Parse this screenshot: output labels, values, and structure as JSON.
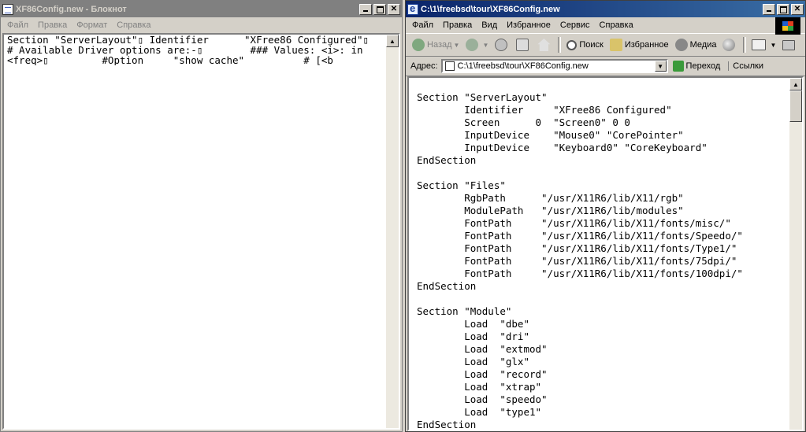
{
  "notepad": {
    "title": "XF86Config.new - Блокнот",
    "menu": [
      "Файл",
      "Правка",
      "Формат",
      "Справка"
    ],
    "lines": [
      "Section \"ServerLayout\"▯ Identifier      \"XFree86 Configured\"▯",
      "# Available Driver options are:-▯        ### Values: <i>: in",
      "<freq>▯         #Option     \"show_cache\"          # [<b"
    ]
  },
  "browser": {
    "title": "C:\\1\\freebsd\\tour\\XF86Config.new",
    "menu": [
      "Файл",
      "Правка",
      "Вид",
      "Избранное",
      "Сервис",
      "Справка"
    ],
    "toolbar": {
      "back": "Назад",
      "search": "Поиск",
      "favorites": "Избранное",
      "media": "Медиа"
    },
    "address": {
      "label": "Адрес:",
      "value": "C:\\1\\freebsd\\tour\\XF86Config.new",
      "go": "Переход",
      "links": "Ссылки"
    },
    "content_lines": [
      "Section \"ServerLayout\"",
      "        Identifier     \"XFree86 Configured\"",
      "        Screen      0  \"Screen0\" 0 0",
      "        InputDevice    \"Mouse0\" \"CorePointer\"",
      "        InputDevice    \"Keyboard0\" \"CoreKeyboard\"",
      "EndSection",
      "",
      "Section \"Files\"",
      "        RgbPath      \"/usr/X11R6/lib/X11/rgb\"",
      "        ModulePath   \"/usr/X11R6/lib/modules\"",
      "        FontPath     \"/usr/X11R6/lib/X11/fonts/misc/\"",
      "        FontPath     \"/usr/X11R6/lib/X11/fonts/Speedo/\"",
      "        FontPath     \"/usr/X11R6/lib/X11/fonts/Type1/\"",
      "        FontPath     \"/usr/X11R6/lib/X11/fonts/75dpi/\"",
      "        FontPath     \"/usr/X11R6/lib/X11/fonts/100dpi/\"",
      "EndSection",
      "",
      "Section \"Module\"",
      "        Load  \"dbe\"",
      "        Load  \"dri\"",
      "        Load  \"extmod\"",
      "        Load  \"glx\"",
      "        Load  \"record\"",
      "        Load  \"xtrap\"",
      "        Load  \"speedo\"",
      "        Load  \"type1\"",
      "EndSection"
    ]
  }
}
